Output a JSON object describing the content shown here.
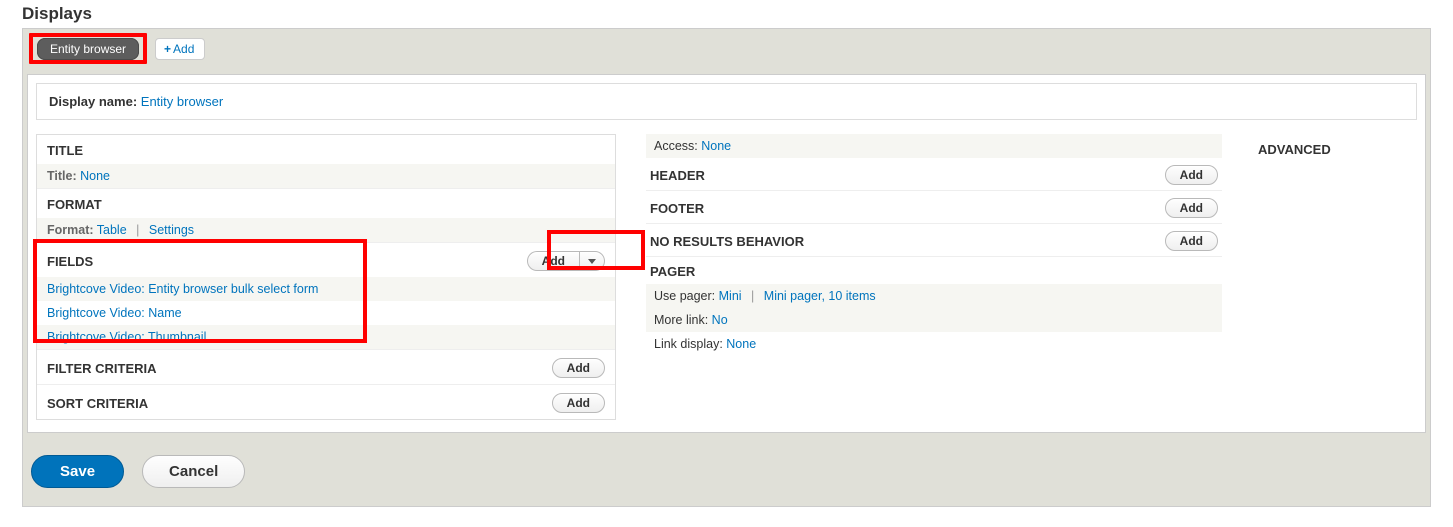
{
  "page_title": "Displays",
  "tabs": {
    "active": "Entity browser",
    "add": "Add"
  },
  "display_name": {
    "label": "Display name:",
    "value": "Entity browser"
  },
  "title_section": {
    "heading": "TITLE",
    "title_label": "Title:",
    "title_value": "None"
  },
  "format_section": {
    "heading": "FORMAT",
    "format_label": "Format:",
    "format_value": "Table",
    "settings": "Settings"
  },
  "fields_section": {
    "heading": "FIELDS",
    "add": "Add",
    "items": [
      "Brightcove Video: Entity browser bulk select form",
      "Brightcove Video: Name",
      "Brightcove Video: Thumbnail"
    ]
  },
  "filter_section": {
    "heading": "FILTER CRITERIA",
    "add": "Add"
  },
  "sort_section": {
    "heading": "SORT CRITERIA",
    "add": "Add"
  },
  "access": {
    "label": "Access:",
    "value": "None"
  },
  "header": {
    "heading": "HEADER",
    "add": "Add"
  },
  "footer": {
    "heading": "FOOTER",
    "add": "Add"
  },
  "noresults": {
    "heading": "NO RESULTS BEHAVIOR",
    "add": "Add"
  },
  "pager": {
    "heading": "PAGER",
    "use_label": "Use pager:",
    "use_value": "Mini",
    "detail": "Mini pager, 10 items",
    "more_label": "More link:",
    "more_value": "No",
    "link_label": "Link display:",
    "link_value": "None"
  },
  "advanced": "ADVANCED",
  "buttons": {
    "save": "Save",
    "cancel": "Cancel"
  }
}
